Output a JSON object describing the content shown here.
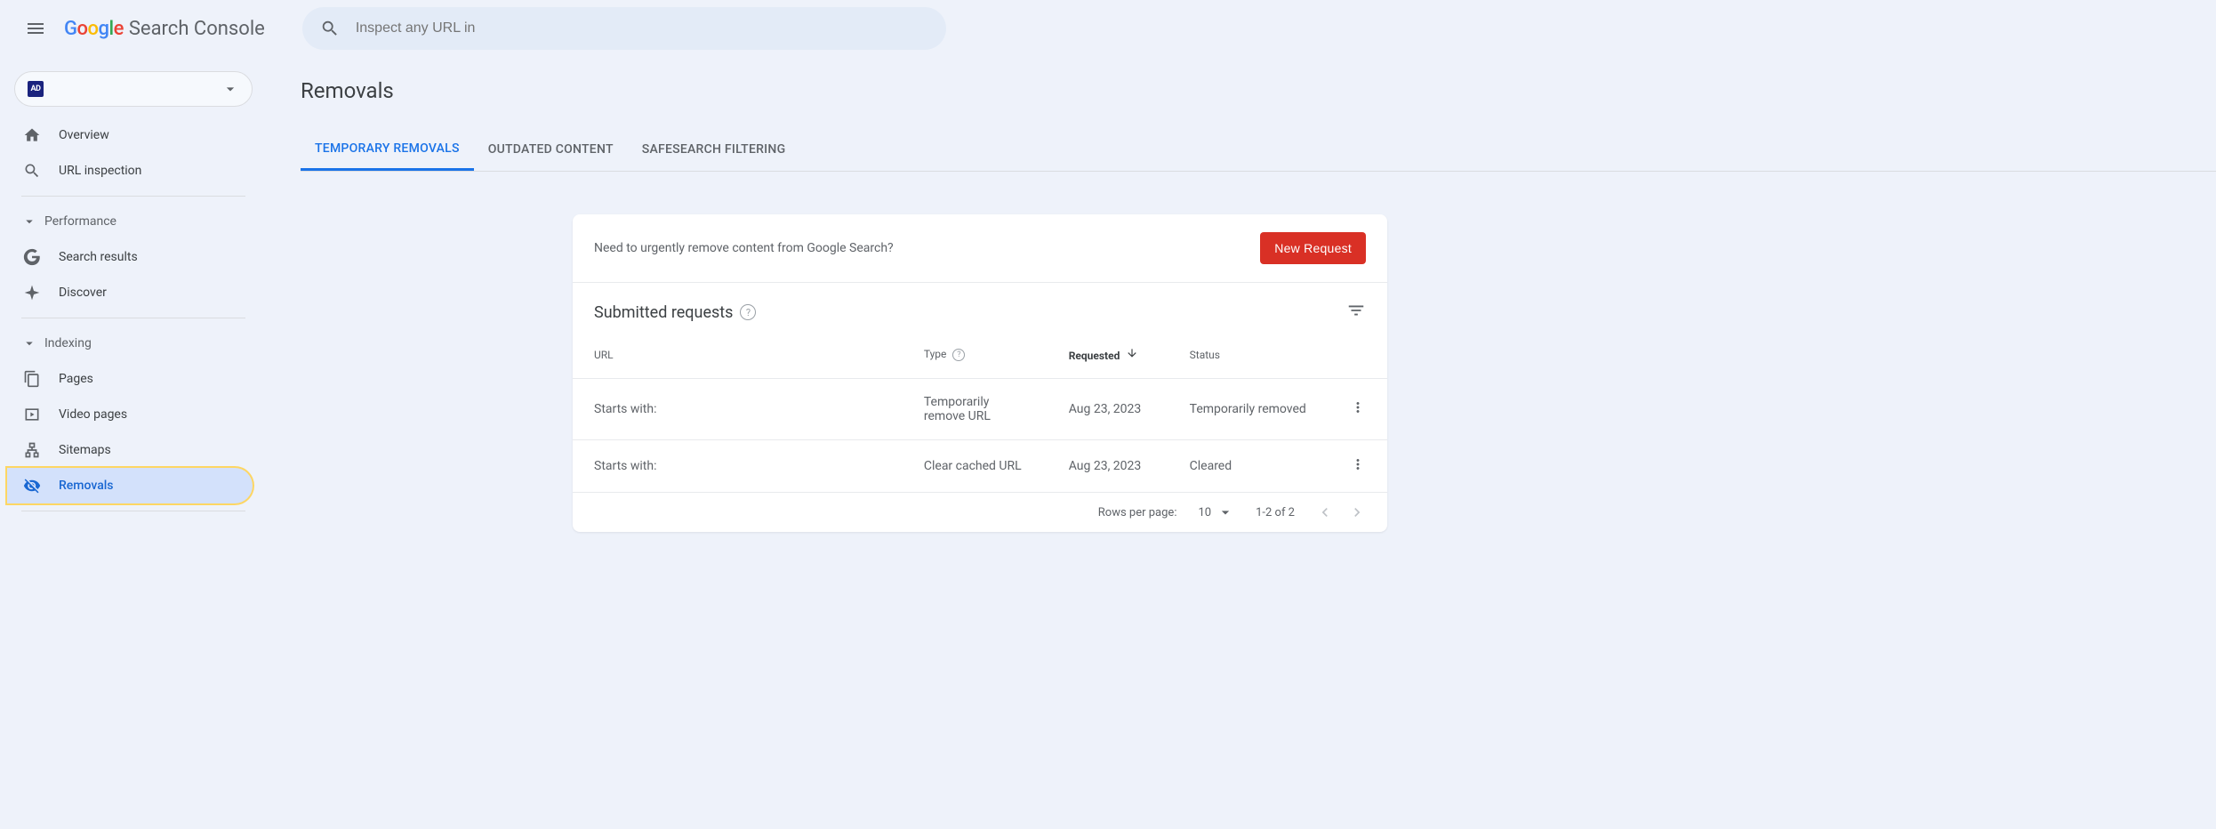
{
  "header": {
    "product_name": "Search Console",
    "search_placeholder": "Inspect any URL in"
  },
  "sidebar": {
    "property_badge": "AD",
    "items": {
      "overview": "Overview",
      "url_inspection": "URL inspection",
      "performance_section": "Performance",
      "search_results": "Search results",
      "discover": "Discover",
      "indexing_section": "Indexing",
      "pages": "Pages",
      "video_pages": "Video pages",
      "sitemaps": "Sitemaps",
      "removals": "Removals"
    }
  },
  "main": {
    "page_title": "Removals",
    "tabs": {
      "temporary": "Temporary Removals",
      "outdated": "Outdated Content",
      "safesearch": "SafeSearch filtering"
    },
    "card": {
      "prompt": "Need to urgently remove content from Google Search?",
      "new_request": "New Request",
      "subtitle": "Submitted requests",
      "columns": {
        "url": "URL",
        "type": "Type",
        "requested": "Requested",
        "status": "Status"
      },
      "rows": [
        {
          "url": "Starts with:",
          "type": "Temporarily remove URL",
          "requested": "Aug 23, 2023",
          "status": "Temporarily removed"
        },
        {
          "url": "Starts with:",
          "type": "Clear cached URL",
          "requested": "Aug 23, 2023",
          "status": "Cleared"
        }
      ],
      "footer": {
        "rows_label": "Rows per page:",
        "rows_value": "10",
        "range": "1-2 of 2"
      }
    }
  }
}
